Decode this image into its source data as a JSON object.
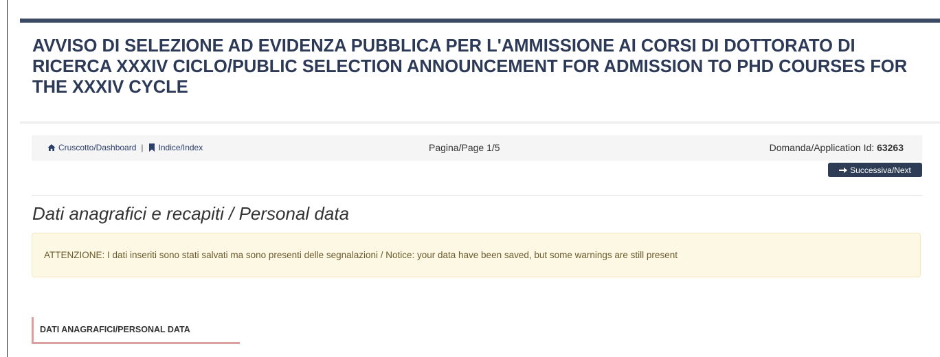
{
  "header": {
    "title": "AVVISO DI SELEZIONE AD EVIDENZA PUBBLICA PER L'AMMISSIONE AI CORSI DI DOTTORATO DI RICERCA XXXIV CICLO/PUBLIC SELECTION ANNOUNCEMENT FOR ADMISSION TO PHD COURSES FOR THE XXXIV CYCLE"
  },
  "nav": {
    "dashboard_label": "Cruscotto/Dashboard",
    "separator": "|",
    "index_label": "Indice/Index",
    "page_indicator": "Pagina/Page 1/5",
    "application_label": "Domanda/Application Id:",
    "application_id": "63263",
    "next_label": "Successiva/Next"
  },
  "section": {
    "title": "Dati anagrafici e recapiti / Personal data"
  },
  "alert": {
    "text": "ATTENZIONE: I dati inseriti sono stati salvati ma sono presenti delle segnalazioni / Notice: your data have been saved, but some warnings are still present"
  },
  "subsection": {
    "label": "DATI ANAGRAFICI/PERSONAL DATA"
  },
  "icons": {
    "home": "home-icon",
    "bookmark": "bookmark-icon",
    "arrow": "arrow-right-icon"
  },
  "colors": {
    "brand": "#2d3a57",
    "alert_bg": "#fcf8e3",
    "accent_border": "#d9a0a0",
    "button": "#2e3d55"
  }
}
